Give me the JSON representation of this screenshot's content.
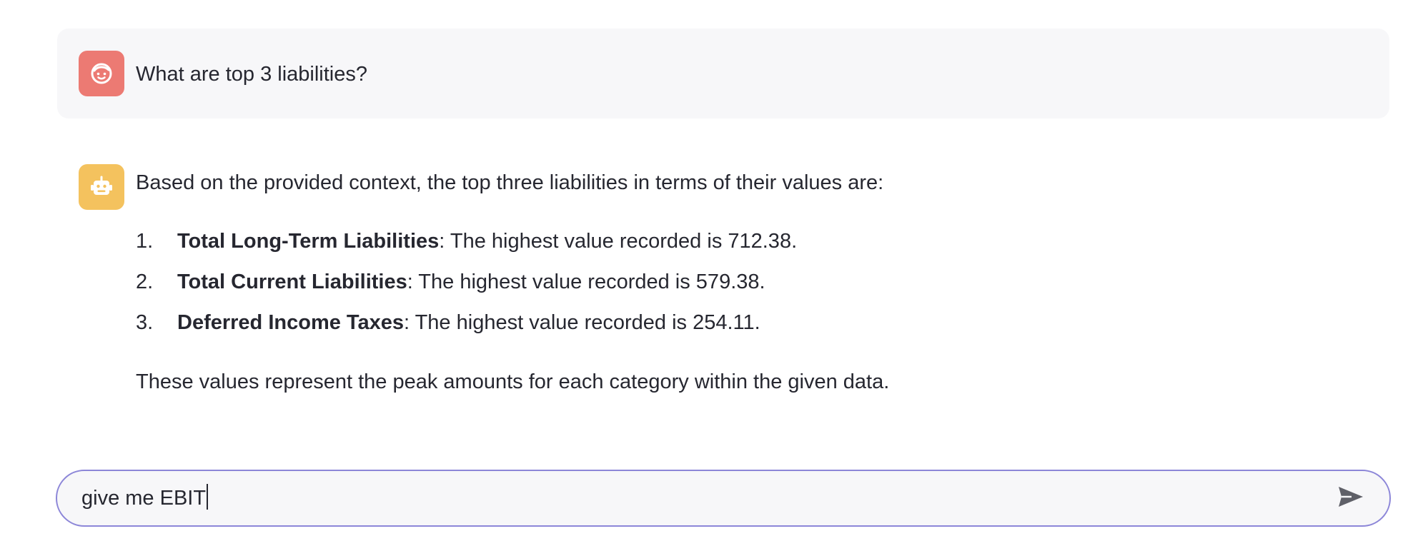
{
  "user_message": {
    "avatar_icon": "user-face-icon",
    "avatar_color": "#ec7a73",
    "text": "What are top 3 liabilities?"
  },
  "assistant_message": {
    "avatar_icon": "robot-icon",
    "avatar_color": "#f4c25e",
    "intro": "Based on the provided context, the top three liabilities in terms of their values are:",
    "items": [
      {
        "number": "1.",
        "term": "Total Long-Term Liabilities",
        "text": ": The highest value recorded is 712.38."
      },
      {
        "number": "2.",
        "term": "Total Current Liabilities",
        "text": ": The highest value recorded is 579.38."
      },
      {
        "number": "3.",
        "term": "Deferred Income Taxes",
        "text": ": The highest value recorded is 254.11."
      }
    ],
    "outro": "These values represent the peak amounts for each category within the given data."
  },
  "chat_input": {
    "value": "give me EBIT",
    "send_icon": "send-icon",
    "border_color": "#8c86d8"
  }
}
